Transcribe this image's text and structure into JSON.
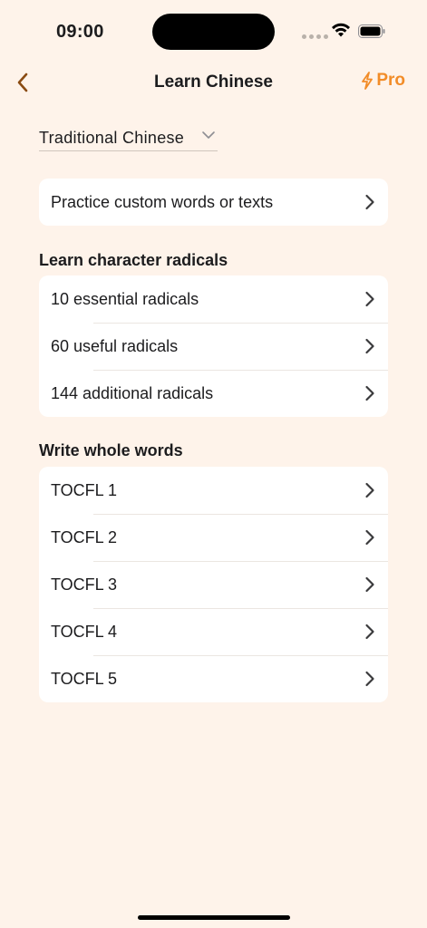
{
  "status": {
    "time": "09:00"
  },
  "nav": {
    "title": "Learn Chinese",
    "pro_label": "Pro"
  },
  "script_select": {
    "value": "Traditional Chinese"
  },
  "custom": {
    "label": "Practice custom words or texts"
  },
  "radicals": {
    "header": "Learn character radicals",
    "items": [
      "10 essential radicals",
      "60 useful radicals",
      "144 additional radicals"
    ]
  },
  "words": {
    "header": "Write whole words",
    "items": [
      "TOCFL 1",
      "TOCFL 2",
      "TOCFL 3",
      "TOCFL 4",
      "TOCFL 5"
    ]
  },
  "colors": {
    "background": "#FEF3EA",
    "accent_back": "#8A4B12",
    "accent_pro": "#F28C28"
  },
  "icons": [
    "back-chevron-icon",
    "lightning-bolt-icon",
    "chevron-down-icon",
    "chevron-right-icon",
    "wifi-icon",
    "battery-icon"
  ]
}
